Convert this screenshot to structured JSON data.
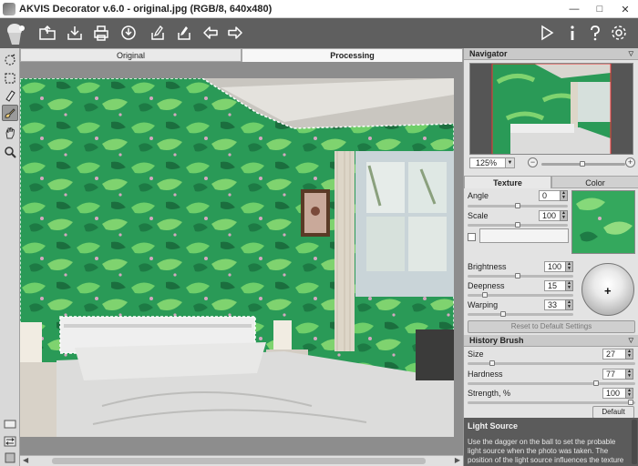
{
  "window": {
    "title": "AKVIS Decorator v.6.0 - original.jpg (RGB/8, 640x480)",
    "minimize": "—",
    "maximize": "□",
    "close": "✕"
  },
  "toolbar": {
    "buttons": [
      "open-icon",
      "save-icon",
      "print-icon",
      "share-icon",
      "import-preset-icon",
      "export-preset-icon",
      "undo-icon",
      "redo-icon"
    ],
    "right_buttons": [
      "run-icon",
      "info-icon",
      "help-icon",
      "settings-icon"
    ]
  },
  "left_tools": [
    "selection-brush-icon",
    "rect-selection-icon",
    "eraser-icon",
    "history-brush-icon",
    "hand-icon",
    "zoom-icon"
  ],
  "tabs": {
    "original": "Original",
    "processing": "Processing"
  },
  "navigator": {
    "title": "Navigator",
    "zoom_value": "125%",
    "zoom_minus": "−",
    "zoom_plus": "+"
  },
  "texture_panel": {
    "tab_texture": "Texture",
    "tab_color": "Color",
    "angle_label": "Angle",
    "angle_value": "0",
    "scale_label": "Scale",
    "scale_value": "100",
    "brightness_label": "Brightness",
    "brightness_value": "100",
    "deepness_label": "Deepness",
    "deepness_value": "15",
    "warping_label": "Warping",
    "warping_value": "33",
    "light_ball_symbol": "+",
    "reset_button": "Reset to Default Settings"
  },
  "history_brush": {
    "title": "History Brush",
    "size_label": "Size",
    "size_value": "27",
    "hardness_label": "Hardness",
    "hardness_value": "77",
    "strength_label": "Strength, %",
    "strength_value": "100",
    "default_button": "Default"
  },
  "light_source": {
    "title": "Light Source",
    "description": "Use the dagger on the ball to set the probable light source when the photo was taken. The position of the light source influences the texture"
  },
  "colors": {
    "toolbar_bg": "#5f5f5f",
    "wall_green": "#2fa35a",
    "panel_bg": "#e3e3e3"
  }
}
